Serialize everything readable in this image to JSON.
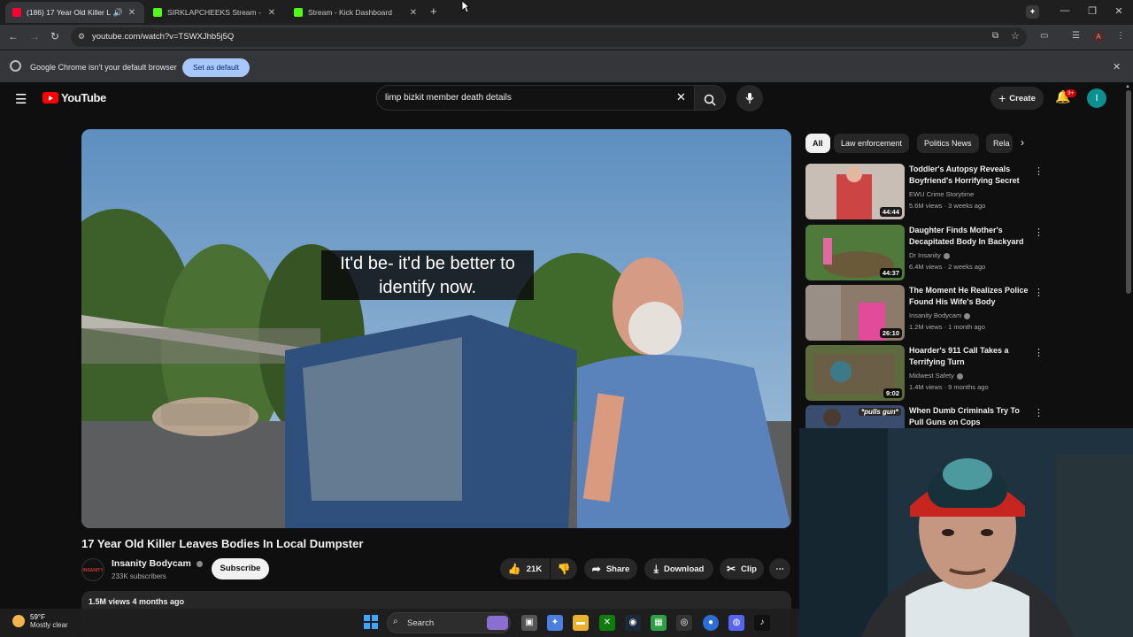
{
  "browser": {
    "tabs": [
      {
        "title": "(186) 17 Year Old Killer Lea...",
        "favicon_color": "#ff0033"
      },
      {
        "title": "SIRKLAPCHEEKS Stream - Watch",
        "favicon_color": "#53fc18"
      },
      {
        "title": "Stream - Kick Dashboard",
        "favicon_color": "#53fc18"
      }
    ],
    "new_tab": "+",
    "url": "youtube.com/watch?v=TSWXJhb5j5Q",
    "profile_initial": "A",
    "infobar_text": "Google Chrome isn't your default browser",
    "set_default_label": "Set as default"
  },
  "youtube": {
    "logo_text": "YouTube",
    "search_query": "limp bizkit member death details",
    "create_label": "Create",
    "notification_count": "9+",
    "avatar_initial": "I",
    "caption": "It'd be- it'd be better to identify now.",
    "video_title": "17 Year Old Killer Leaves Bodies In Local Dumpster",
    "channel_name": "Insanity Bodycam",
    "channel_avatar_text": "INSANITY BODYCAM",
    "subscribers": "233K subscribers",
    "subscribe_label": "Subscribe",
    "likes": "21K",
    "share_label": "Share",
    "download_label": "Download",
    "clip_label": "Clip",
    "views_age": "1.5M views  4 months ago",
    "chips": [
      "All",
      "Law enforcement",
      "Politics News",
      "Rela"
    ],
    "recommendations": [
      {
        "title": "Toddler's Autopsy Reveals Boyfriend's Horrifying Secret",
        "channel": "EWU Crime Storytime",
        "verified": false,
        "meta": "5.6M views · 3 weeks ago",
        "duration": "44:44",
        "thumb_color": "#b9a7a0"
      },
      {
        "title": "Daughter Finds Mother's Decapitated Body In Backyard",
        "channel": "Dr Insanity",
        "verified": true,
        "meta": "6.4M views · 2 weeks ago",
        "duration": "44:37",
        "thumb_color": "#4f7a3c"
      },
      {
        "title": "The Moment He Realizes Police Found His Wife's Body",
        "channel": "Insanity Bodycam",
        "verified": true,
        "meta": "1.2M views · 1 month ago",
        "duration": "26:10",
        "thumb_color": "#8c7a6b"
      },
      {
        "title": "Hoarder's 911 Call Takes a Terrifying Turn",
        "channel": "Midwest Safety",
        "verified": true,
        "meta": "1.4M views · 9 months ago",
        "duration": "9:02",
        "thumb_color": "#5c6a3e"
      },
      {
        "title": "When Dumb Criminals Try To Pull Guns on Cops",
        "channel": "",
        "verified": false,
        "meta": "",
        "duration": "",
        "thumb_color": "#3a4d6e",
        "thumb_text": "*pulls gun*"
      }
    ]
  },
  "taskbar": {
    "temperature": "59°F",
    "condition": "Mostly clear",
    "search_label": "Search"
  },
  "colors": {
    "youtube_red": "#ff0000",
    "background": "#0f0f0f",
    "set_default_bg": "#a8c7fa"
  }
}
